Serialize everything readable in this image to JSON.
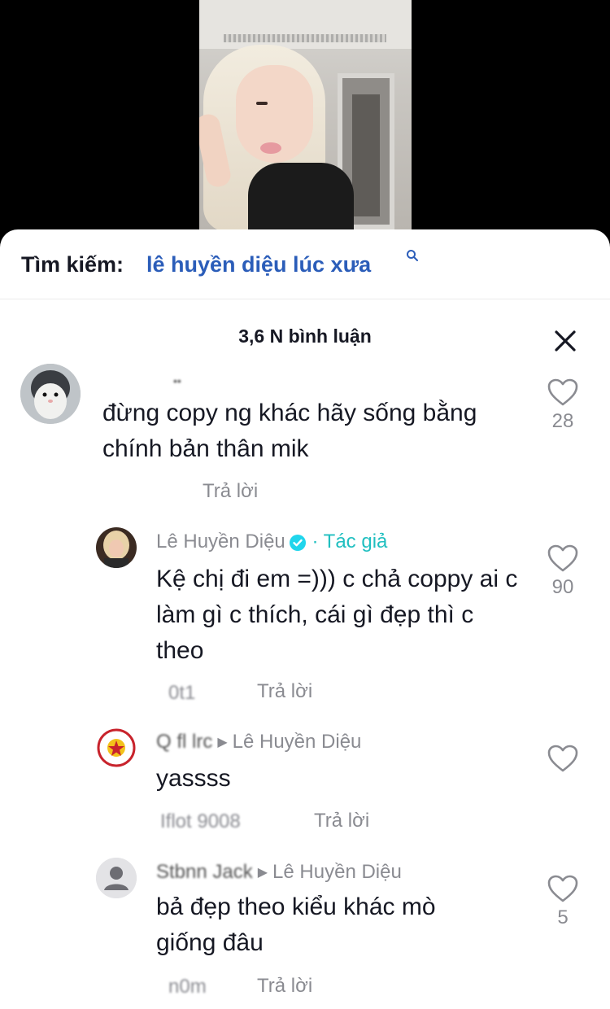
{
  "search": {
    "label": "Tìm kiếm:",
    "term": "lê huyền diệu lúc xưa"
  },
  "comments_header": {
    "count_label": "3,6 N bình luận"
  },
  "comments": [
    {
      "username": "••",
      "text": "đừng copy ng khác hãy sống bằng chính bản thân mik",
      "reply_label": "Trả lời",
      "likes": "28"
    },
    {
      "username": "Lê Huyền Diệu",
      "author_label": "· Tác giả",
      "text": "Kệ chị đi em =))) c chả coppy ai c làm gì c thích, cái gì đẹp thì c theo",
      "meta": "0t1",
      "reply_label": "Trả lời",
      "likes": "90"
    },
    {
      "username": "Q fl lrc",
      "reply_to": "Lê Huyền Diệu",
      "text": "yassss",
      "meta": "Iflot 9008",
      "reply_label": "Trả lời",
      "likes": ""
    },
    {
      "username": "Stbnn Jack",
      "reply_to": "Lê Huyền Diệu",
      "text": "bả đẹp theo kiểu khác mò giống đâu",
      "meta": "n0m",
      "reply_label": "Trả lời",
      "likes": "5"
    }
  ],
  "colors": {
    "accent_link": "#2b5db9",
    "author_badge": "#20bfc0",
    "muted": "#8a8b91"
  },
  "icons": [
    "search-icon",
    "close-icon",
    "heart-icon",
    "verified-icon",
    "avatar"
  ]
}
